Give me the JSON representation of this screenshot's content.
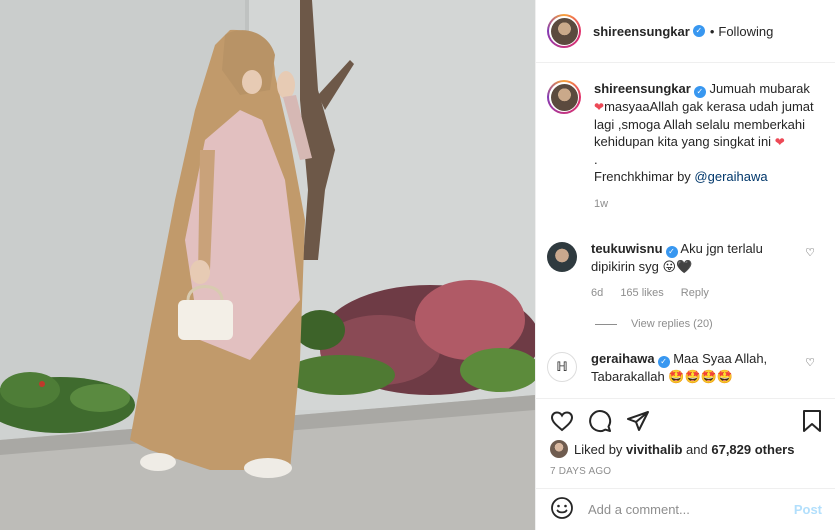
{
  "post_header": {
    "username": "shireensungkar",
    "separator": "•",
    "follow_status": "Following"
  },
  "caption": {
    "username": "shireensungkar",
    "line1": "Jumuah mubarak",
    "line2": "masyaaAllah gak kerasa udah jumat lagi ,smoga Allah selalu memberkahi kehidupan kita yang singkat ini",
    "dot": ".",
    "line3_prefix": "Frenchkhimar by ",
    "mention": "@geraihawa",
    "age": "1w"
  },
  "comments": [
    {
      "username": "teukuwisnu",
      "text": "Aku jgn terlalu dipikirin syg",
      "emoji": "😛🖤",
      "age": "6d",
      "likes": "165 likes",
      "reply": "Reply"
    },
    {
      "username": "geraihawa",
      "text": "Maa Syaa Allah, Tabarakallah",
      "emoji": "🤩🤩🤩🤩"
    }
  ],
  "view_replies": "View replies (20)",
  "likes": {
    "prefix": "Liked by ",
    "user": "vivithalib",
    "middle": " and ",
    "count": "67,829 others"
  },
  "posted_time": "7 DAYS AGO",
  "comment_box": {
    "placeholder": "Add a comment...",
    "post_label": "Post"
  },
  "icons": {
    "like": "heart-outline-icon",
    "comment": "comment-bubble-icon",
    "share": "paper-plane-icon",
    "save": "bookmark-icon",
    "emoji": "smiley-icon",
    "verified": "verified-badge-icon"
  },
  "colors": {
    "verified_blue": "#3897f0",
    "post_disabled": "#b2dffc",
    "heart_red": "#ed4956",
    "mention_blue": "#00376b"
  }
}
